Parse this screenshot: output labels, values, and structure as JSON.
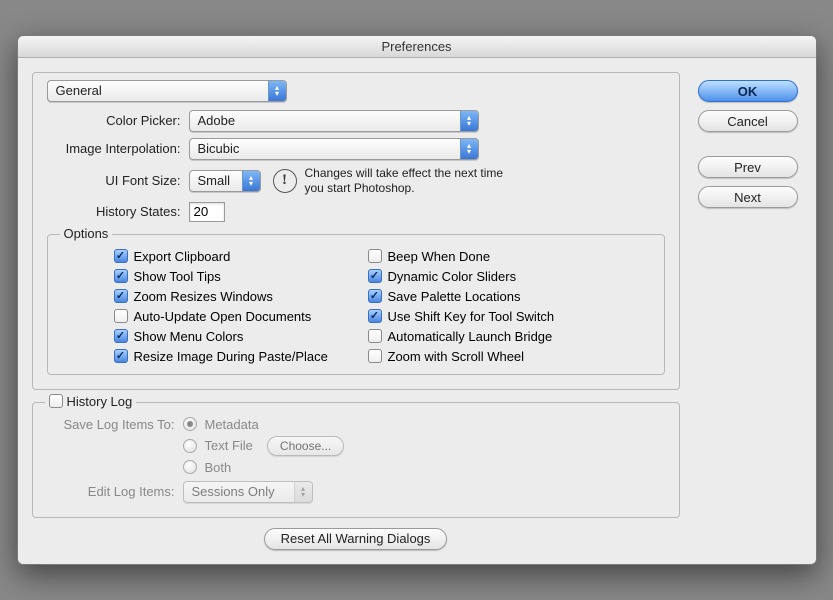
{
  "title": "Preferences",
  "section_popup": "General",
  "labels": {
    "color_picker": "Color Picker:",
    "image_interp": "Image Interpolation:",
    "ui_font": "UI Font Size:",
    "history_states": "History States:",
    "options_legend": "Options",
    "history_log_legend": "History Log",
    "save_log": "Save Log Items To:",
    "edit_log": "Edit Log Items:"
  },
  "values": {
    "color_picker": "Adobe",
    "image_interp": "Bicubic",
    "ui_font": "Small",
    "history_states": "20",
    "edit_log": "Sessions Only"
  },
  "note": "Changes will take effect the next time you start Photoshop.",
  "options_col1": [
    {
      "label": "Export Clipboard",
      "checked": true
    },
    {
      "label": "Show Tool Tips",
      "checked": true
    },
    {
      "label": "Zoom Resizes Windows",
      "checked": true
    },
    {
      "label": "Auto-Update Open Documents",
      "checked": false
    },
    {
      "label": "Show Menu Colors",
      "checked": true
    },
    {
      "label": "Resize Image During Paste/Place",
      "checked": true
    }
  ],
  "options_col2": [
    {
      "label": "Beep When Done",
      "checked": false
    },
    {
      "label": "Dynamic Color Sliders",
      "checked": true
    },
    {
      "label": "Save Palette Locations",
      "checked": true
    },
    {
      "label": "Use Shift Key for Tool Switch",
      "checked": true
    },
    {
      "label": "Automatically Launch Bridge",
      "checked": false
    },
    {
      "label": "Zoom with Scroll Wheel",
      "checked": false
    }
  ],
  "history_log_checked": false,
  "log_radios": {
    "metadata": "Metadata",
    "textfile": "Text File",
    "both": "Both"
  },
  "buttons": {
    "ok": "OK",
    "cancel": "Cancel",
    "prev": "Prev",
    "next": "Next",
    "choose": "Choose...",
    "reset": "Reset All Warning Dialogs"
  }
}
